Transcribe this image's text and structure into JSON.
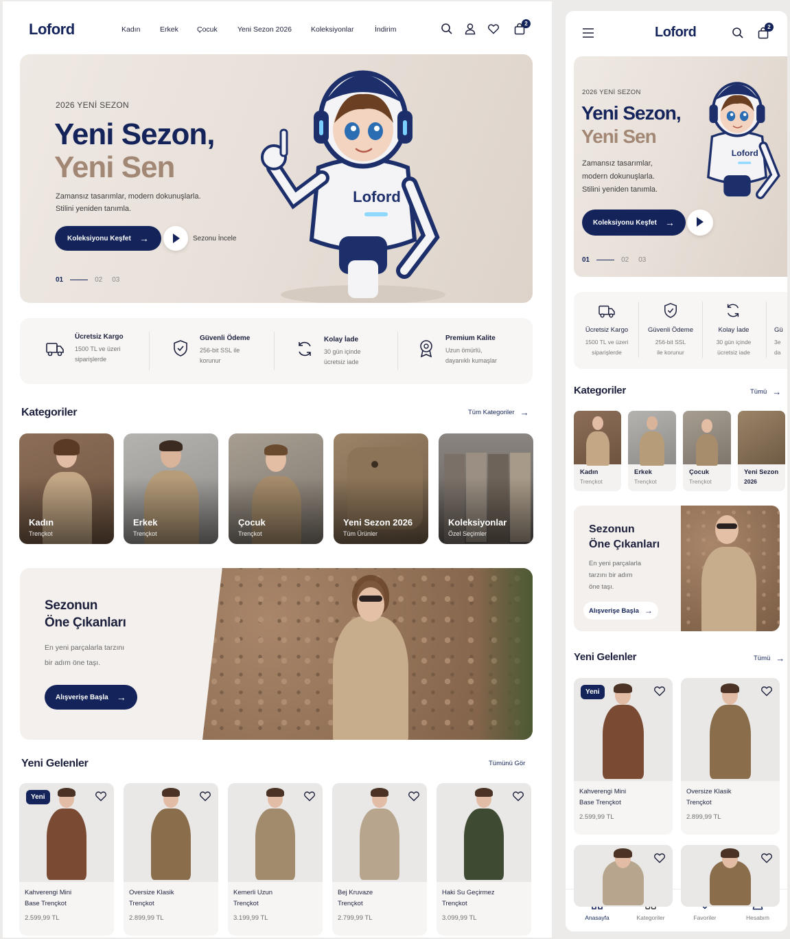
{
  "brand": "Loford",
  "nav": [
    "Kadın",
    "Erkek",
    "Çocuk",
    "Yeni Sezon 2026",
    "Koleksiyonlar",
    "İndirim"
  ],
  "cart_count": "2",
  "hero": {
    "eyebrow": "2026 YENİ SEZON",
    "title_line1": "Yeni Sezon,",
    "title_line2": "Yeni Sen",
    "subtitle_line1": "Zamansız tasarımlar, modern dokunuşlarla.",
    "subtitle_line2": "Stilini yeniden tanımla.",
    "mobile_subtitle_line1": "Zamansız tasarımlar,",
    "mobile_subtitle_line2": "modern dokunuşlarla.",
    "mobile_subtitle_line3": "Stilini yeniden tanımla.",
    "cta": "Koleksiyonu Keşfet",
    "secondary": "Sezonu İncele",
    "robot_logo": "Loford",
    "pager": [
      "01",
      "02",
      "03"
    ]
  },
  "features": [
    {
      "title": "Ücretsiz Kargo",
      "desc1": "1500 TL ve üzeri",
      "desc2": "siparişlerde",
      "icon": "truck-icon"
    },
    {
      "title": "Güvenli Ödeme",
      "desc1": "256-bit SSL ile",
      "desc2": "korunur",
      "icon": "shield-icon"
    },
    {
      "title": "Kolay İade",
      "desc1": "30 gün içinde",
      "desc2": "ücretsiz iade",
      "icon": "refresh-icon"
    },
    {
      "title": "Premium Kalite",
      "desc1": "Uzun ömürlü,",
      "desc2": "dayanıklı kumaşlar",
      "icon": "quality-badge-icon"
    }
  ],
  "mobile_features": [
    {
      "title": "Ücretsiz Kargo",
      "desc1": "1500 TL ve üzeri",
      "desc2": "siparişlerde"
    },
    {
      "title": "Güvenli Ödeme",
      "desc1": "256-bit SSL",
      "desc2": "ile korunur"
    },
    {
      "title": "Kolay İade",
      "desc1": "30 gün içinde",
      "desc2": "ücretsiz iade"
    },
    {
      "title": "Gü",
      "desc1": "3e",
      "desc2": "da"
    }
  ],
  "categories_section": {
    "title": "Kategoriler",
    "link": "Tüm Kategoriler",
    "mobile_link": "Tümü"
  },
  "categories": [
    {
      "title": "Kadın",
      "sub": "Trençkot"
    },
    {
      "title": "Erkek",
      "sub": "Trençkot"
    },
    {
      "title": "Çocuk",
      "sub": "Trençkot"
    },
    {
      "title": "Yeni Sezon 2026",
      "sub": "Tüm Ürünler"
    },
    {
      "title": "Koleksiyonlar",
      "sub": "Özel Seçimler"
    }
  ],
  "mobile_categories": [
    {
      "title": "Kadın",
      "sub": "Trençkot"
    },
    {
      "title": "Erkek",
      "sub": "Trençkot"
    },
    {
      "title": "Çocuk",
      "sub": "Trençkot"
    },
    {
      "title": "Yeni Sezon",
      "sub": "2026"
    }
  ],
  "promo": {
    "title_line1": "Sezonun",
    "title_line2": "Öne Çıkanları",
    "desc_line1": "En yeni parçalarla tarzını",
    "desc_line2": "bir adım öne taşı.",
    "mobile_desc_line1": "En yeni parçalarla",
    "mobile_desc_line2": "tarzını bir adım",
    "mobile_desc_line3": "öne taşı.",
    "cta": "Alışverişe Başla"
  },
  "new_section": {
    "title": "Yeni Gelenler",
    "link": "Tümünü Gör",
    "mobile_link": "Tümü"
  },
  "new_tag": "Yeni",
  "products": [
    {
      "name1": "Kahverengi Mini",
      "name2": "Base Trençkot",
      "price": "2.599,99 TL",
      "coat": "#7a4a33"
    },
    {
      "name1": "Oversize Klasik",
      "name2": "Trençkot",
      "price": "2.899,99 TL",
      "coat": "#8a6d4b"
    },
    {
      "name1": "Kemerli Uzun",
      "name2": "Trençkot",
      "price": "3.199,99 TL",
      "coat": "#a28a6c"
    },
    {
      "name1": "Bej Kruvaze",
      "name2": "Trençkot",
      "price": "2.799,99 TL",
      "coat": "#b7a58d"
    },
    {
      "name1": "Haki Su Geçirmez",
      "name2": "Trençkot",
      "price": "3.099,99 TL",
      "coat": "#3f4a33"
    }
  ],
  "tabbar": [
    {
      "label": "Anasayfa",
      "icon": "home-icon"
    },
    {
      "label": "Kategoriler",
      "icon": "grid-icon"
    },
    {
      "label": "Favoriler",
      "icon": "heart-icon"
    },
    {
      "label": "Hesabım",
      "icon": "user-icon"
    }
  ],
  "colors": {
    "navy": "#14245a",
    "taupe": "#a28874",
    "background": "#ecebea"
  }
}
